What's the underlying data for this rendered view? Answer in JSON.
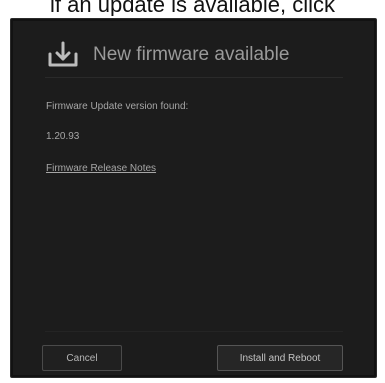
{
  "doc": {
    "line": "if an update is available, click"
  },
  "dialog": {
    "icon": "download-icon",
    "title": "New firmware available",
    "label": "Firmware Update version found:",
    "version": "1.20.93",
    "link_text": "Firmware Release Notes",
    "buttons": {
      "cancel": "Cancel",
      "install": "Install and Reboot"
    }
  },
  "colors": {
    "dialog_bg": "#1c1c1c",
    "text_muted": "#a6a6a6",
    "border": "#4a4a4a"
  }
}
